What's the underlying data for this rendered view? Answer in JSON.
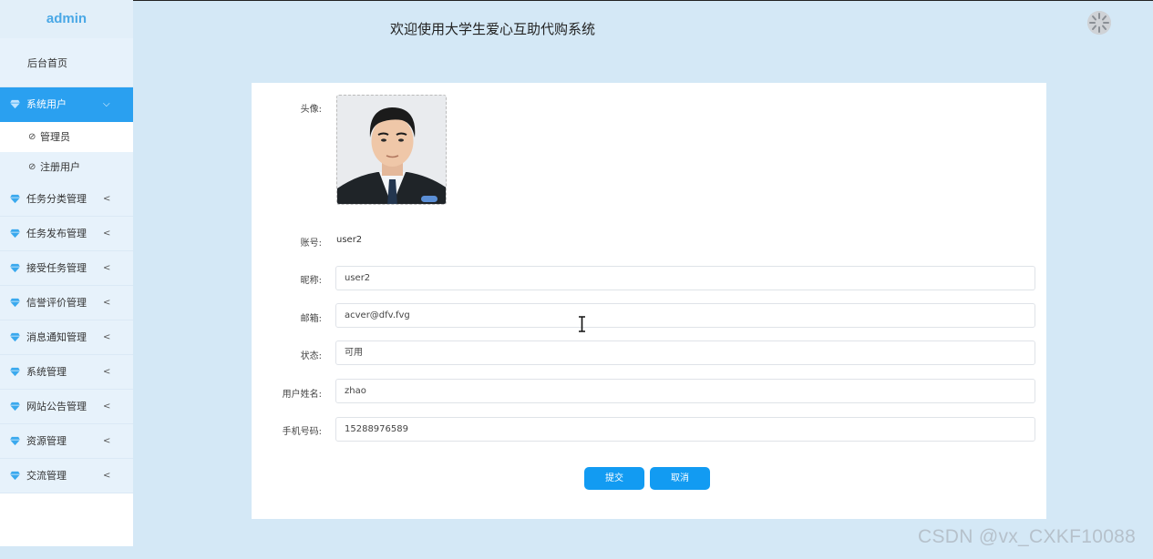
{
  "sidebar": {
    "brand": "admin",
    "home": "后台首页",
    "active_menu": "系统用户",
    "sub_items": [
      "管理员",
      "注册用户"
    ],
    "menus": [
      "任务分类管理",
      "任务发布管理",
      "接受任务管理",
      "信誉评价管理",
      "消息通知管理",
      "系统管理",
      "网站公告管理",
      "资源管理",
      "交流管理"
    ]
  },
  "header": {
    "title": "欢迎使用大学生爱心互助代购系统"
  },
  "form": {
    "avatar_label": "头像:",
    "account_label": "账号:",
    "account_value": "user2",
    "nickname_label": "昵称:",
    "nickname_value": "user2",
    "email_label": "邮箱:",
    "email_value": "acver@dfv.fvg",
    "status_label": "状态:",
    "status_value": "可用",
    "realname_label": "用户姓名:",
    "realname_value": "zhao",
    "phone_label": "手机号码:",
    "phone_value": "15288976589",
    "submit_label": "提交",
    "cancel_label": "取消"
  },
  "watermark": "CSDN @vx_CXKF10088",
  "colors": {
    "page_bg": "#d4e8f6",
    "accent": "#2aa0f0",
    "button": "#129bf2",
    "brand": "#4aa8e6"
  },
  "icons": {
    "menu": "gem-icon",
    "collapse": "chevron-left-icon",
    "expanded": "chevron-down-icon",
    "sub": "check-circle-icon"
  }
}
